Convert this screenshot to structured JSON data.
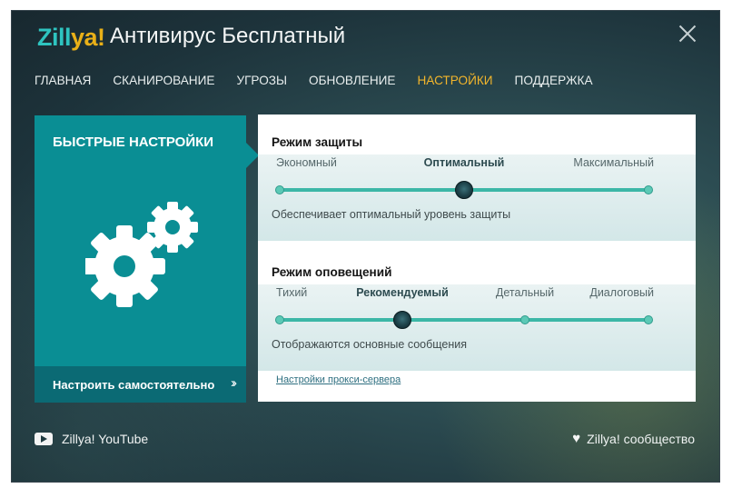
{
  "window": {
    "logo_main": "Zill",
    "logo_accent": "ya!",
    "title": "Антивирус Бесплатный"
  },
  "nav": {
    "items": [
      "ГЛАВНАЯ",
      "СКАНИРОВАНИЕ",
      "УГРОЗЫ",
      "ОБНОВЛЕНИЕ",
      "НАСТРОЙКИ",
      "ПОДДЕРЖКА"
    ],
    "active": "НАСТРОЙКИ"
  },
  "quick": {
    "title": "БЫСТРЫЕ НАСТРОЙКИ",
    "customize_label": "Настроить самостоятельно",
    "customize_arrow": "››"
  },
  "protection": {
    "title": "Режим защиты",
    "levels": [
      "Экономный",
      "Оптимальный",
      "Максимальный"
    ],
    "selected": "Оптимальный",
    "description": "Обеспечивает оптимальный уровень защиты"
  },
  "notifications": {
    "title": "Режим оповещений",
    "levels": [
      "Тихий",
      "Рекомендуемый",
      "Детальный",
      "Диалоговый"
    ],
    "selected": "Рекомендуемый",
    "description": "Отображаются основные сообщения"
  },
  "proxy_link": "Настройки прокси-сервера",
  "footer": {
    "youtube": "Zillya! YouTube",
    "community": "Zillya! сообщество"
  },
  "colors": {
    "accent": "#f1b52c",
    "teal": "#0a8e94",
    "teal_dark": "#0b6a74",
    "slider": "#3cb7a7"
  }
}
